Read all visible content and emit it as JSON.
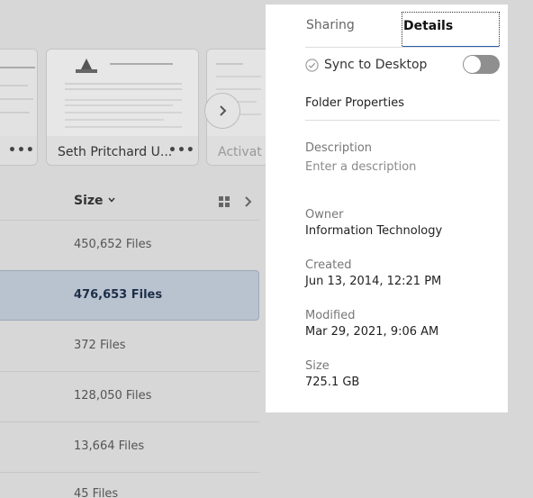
{
  "background": {
    "thumbnails": [
      {
        "caption": "",
        "more": "•••"
      },
      {
        "caption": "Seth Pritchard U...",
        "more": "•••"
      },
      {
        "caption": "Activat",
        "more": ""
      }
    ],
    "column_header": "Size",
    "rows": [
      {
        "size": "450,652 Files"
      },
      {
        "size": "476,653 Files"
      },
      {
        "size": "372 Files"
      },
      {
        "size": "128,050 Files"
      },
      {
        "size": "13,664 Files"
      },
      {
        "size": "45 Files"
      }
    ]
  },
  "panel": {
    "tabs": {
      "sharing": "Sharing",
      "details": "Details"
    },
    "sync_label": "Sync to Desktop",
    "section_title": "Folder Properties",
    "description": {
      "label": "Description",
      "placeholder": "Enter a description"
    },
    "owner": {
      "label": "Owner",
      "value": "Information Technology"
    },
    "created": {
      "label": "Created",
      "value": "Jun 13, 2014, 12:21 PM"
    },
    "modified": {
      "label": "Modified",
      "value": "Mar 29, 2021, 9:06 AM"
    },
    "size": {
      "label": "Size",
      "value": "725.1 GB"
    }
  },
  "colors": {
    "accent": "#2a5db0",
    "selected_row": "#b9c2cf"
  }
}
